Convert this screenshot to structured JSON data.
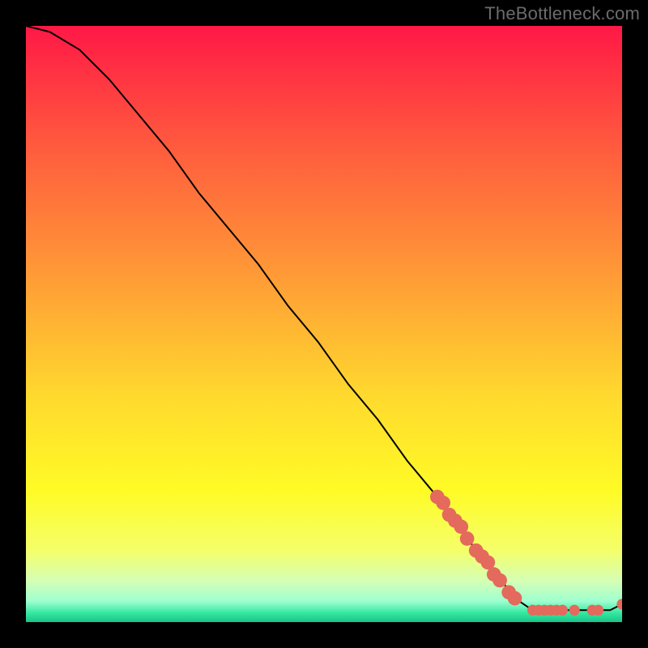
{
  "attribution": "TheBottleneck.com",
  "chart_data": {
    "type": "line",
    "title": "",
    "xlabel": "",
    "ylabel": "",
    "xlim": [
      0,
      100
    ],
    "ylim": [
      0,
      100
    ],
    "gradient_stops": [
      {
        "offset": 0,
        "color": "#ff1846"
      },
      {
        "offset": 0.2,
        "color": "#ff5a3e"
      },
      {
        "offset": 0.42,
        "color": "#ff9b36"
      },
      {
        "offset": 0.62,
        "color": "#ffd92e"
      },
      {
        "offset": 0.78,
        "color": "#fffb26"
      },
      {
        "offset": 0.88,
        "color": "#f4ff6a"
      },
      {
        "offset": 0.93,
        "color": "#d6ffb4"
      },
      {
        "offset": 0.965,
        "color": "#9effd0"
      },
      {
        "offset": 0.985,
        "color": "#34e7a0"
      },
      {
        "offset": 1.0,
        "color": "#18c488"
      }
    ],
    "series": [
      {
        "name": "bottleneck-curve",
        "x": [
          0,
          4,
          9,
          14,
          19,
          24,
          29,
          34,
          39,
          44,
          49,
          54,
          59,
          64,
          69,
          74,
          79,
          82,
          85,
          87,
          89,
          90,
          92,
          94,
          96,
          98,
          100
        ],
        "y": [
          100,
          99,
          96,
          91,
          85,
          79,
          72,
          66,
          60,
          53,
          47,
          40,
          34,
          27,
          21,
          14,
          8,
          4,
          2,
          2,
          2,
          2,
          2,
          2,
          2,
          2,
          3
        ]
      }
    ],
    "markers": [
      {
        "x": 69,
        "y": 21
      },
      {
        "x": 70,
        "y": 20
      },
      {
        "x": 71,
        "y": 18
      },
      {
        "x": 72,
        "y": 17
      },
      {
        "x": 73,
        "y": 16
      },
      {
        "x": 74,
        "y": 14
      },
      {
        "x": 75.5,
        "y": 12
      },
      {
        "x": 76.5,
        "y": 11
      },
      {
        "x": 77.5,
        "y": 10
      },
      {
        "x": 78.5,
        "y": 8
      },
      {
        "x": 79.5,
        "y": 7
      },
      {
        "x": 81,
        "y": 5
      },
      {
        "x": 82,
        "y": 4
      },
      {
        "x": 85,
        "y": 2
      },
      {
        "x": 86,
        "y": 2
      },
      {
        "x": 87,
        "y": 2
      },
      {
        "x": 88,
        "y": 2
      },
      {
        "x": 89,
        "y": 2
      },
      {
        "x": 90,
        "y": 2
      },
      {
        "x": 92,
        "y": 2
      },
      {
        "x": 95,
        "y": 2
      },
      {
        "x": 96,
        "y": 2
      },
      {
        "x": 100,
        "y": 3
      }
    ],
    "marker_radius_large": 1.2,
    "marker_radius_small": 0.9
  }
}
